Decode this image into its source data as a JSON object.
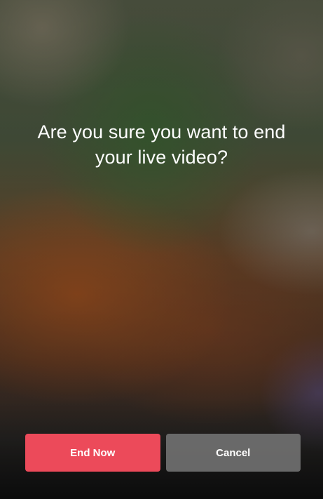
{
  "dialog": {
    "message": "Are you sure you want to end your live video?",
    "end_now_label": "End Now",
    "cancel_label": "Cancel"
  },
  "colors": {
    "end_now_button": "#ec4a5a",
    "cancel_button": "#707070",
    "text": "#ffffff"
  }
}
